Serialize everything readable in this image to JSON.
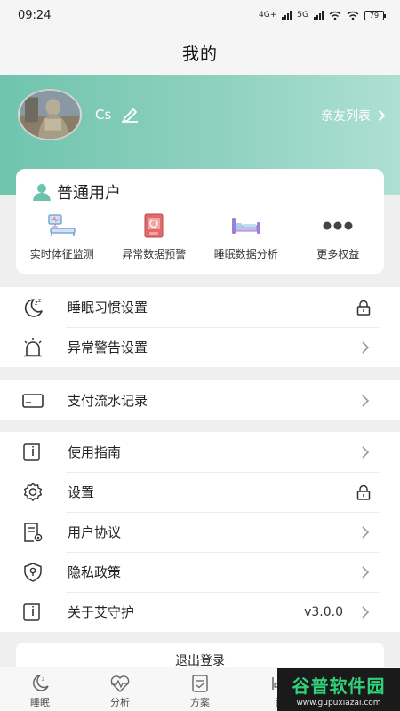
{
  "status": {
    "time": "09:24",
    "net1": "4G+",
    "net2": "5G",
    "battery": "79"
  },
  "nav": {
    "title": "我的"
  },
  "profile": {
    "username": "Cs",
    "friends_link": "亲友列表"
  },
  "member": {
    "level": "普通用户",
    "features": [
      {
        "label": "实时体征监测",
        "icon": "monitor-bed-icon"
      },
      {
        "label": "异常数据预警",
        "icon": "alarm-box-icon"
      },
      {
        "label": "睡眠数据分析",
        "icon": "bed-icon"
      },
      {
        "label": "更多权益",
        "icon": "more-dots-icon"
      }
    ]
  },
  "menu": {
    "sleep_habit": "睡眠习惯设置",
    "alert_setting": "异常警告设置",
    "payment": "支付流水记录",
    "guide": "使用指南",
    "settings": "设置",
    "agreement": "用户协议",
    "privacy": "隐私政策",
    "about": "关于艾守护",
    "version": "v3.0.0"
  },
  "logout": "退出登录",
  "tabs": [
    {
      "label": "睡眠",
      "icon": "moon-icon"
    },
    {
      "label": "分析",
      "icon": "heartbeat-icon"
    },
    {
      "label": "方案",
      "icon": "plan-icon"
    },
    {
      "label": "设",
      "icon": "bed-small-icon"
    }
  ],
  "watermark": {
    "text": "谷普软件园",
    "url": "www.gupuxiazai.com"
  },
  "colors": {
    "accent": "#6fc4ad",
    "member_icon": "#6cc3ad"
  }
}
